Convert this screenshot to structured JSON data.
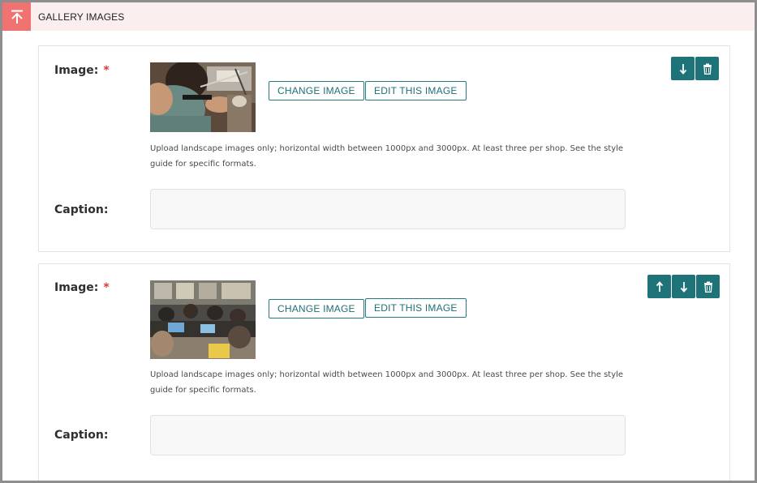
{
  "section": {
    "title": "GALLERY IMAGES",
    "collapse_icon": "collapse-up-icon"
  },
  "colors": {
    "accent": "#1e7379",
    "header_bg": "#fbeeee",
    "collapse_bg": "#f07372",
    "required": "#d73a3a"
  },
  "gallery_items": [
    {
      "image_label": "Image:",
      "required_mark": "*",
      "change_button": "CHANGE IMAGE",
      "edit_button": "EDIT THIS IMAGE",
      "help_text": "Upload landscape images only; horizontal width between 1000px and 3000px. At least three per shop. See the style guide for specific formats.",
      "caption_label": "Caption:",
      "caption_value": "",
      "actions": [
        "move-down-icon",
        "delete-icon"
      ]
    },
    {
      "image_label": "Image:",
      "required_mark": "*",
      "change_button": "CHANGE IMAGE",
      "edit_button": "EDIT THIS IMAGE",
      "help_text": "Upload landscape images only; horizontal width between 1000px and 3000px. At least three per shop. See the style guide for specific formats.",
      "caption_label": "Caption:",
      "caption_value": "",
      "actions": [
        "move-up-icon",
        "move-down-icon",
        "delete-icon"
      ]
    }
  ]
}
